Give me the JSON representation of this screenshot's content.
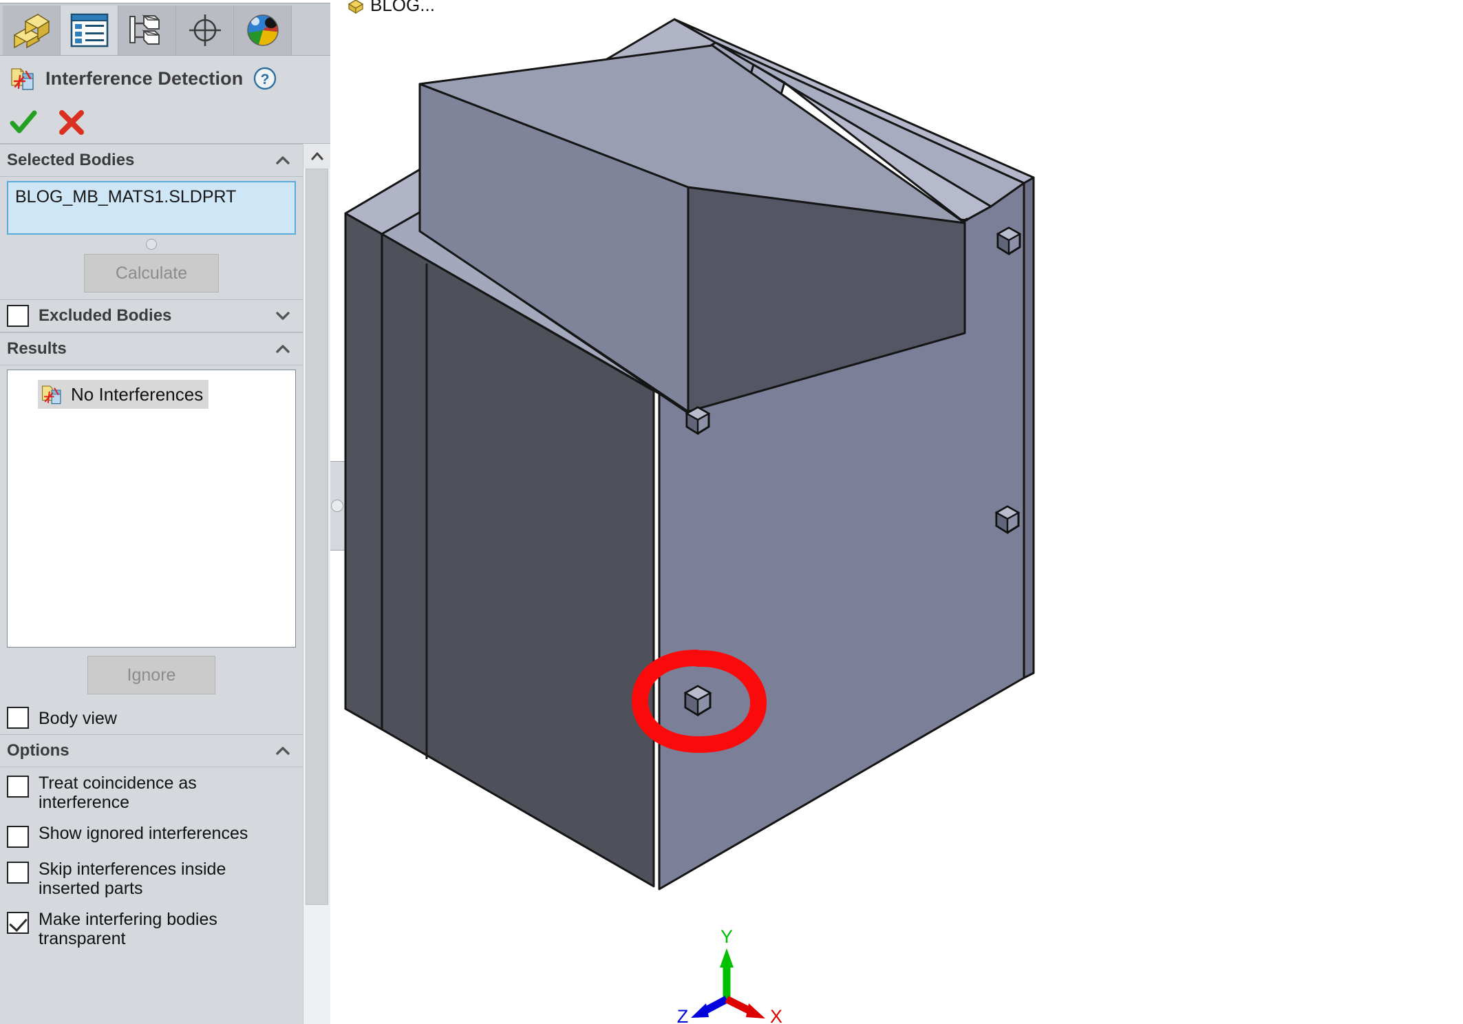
{
  "app": {
    "panel_title": "Interference Detection",
    "panel_icon": "interference-detection-icon",
    "help_icon": "help-question-icon",
    "ok_icon": "green-check-icon",
    "cancel_icon": "red-x-icon"
  },
  "tabs": [
    {
      "id": "feature-manager",
      "icon": "yellow-blocks-icon",
      "active": false
    },
    {
      "id": "property-manager",
      "icon": "blue-list-icon",
      "active": true
    },
    {
      "id": "configuration-manager",
      "icon": "config-tree-icon",
      "active": false
    },
    {
      "id": "dimxpert-manager",
      "icon": "crosshair-target-icon",
      "active": false
    },
    {
      "id": "display-manager",
      "icon": "color-sphere-icon",
      "active": false
    }
  ],
  "sections": {
    "selected_bodies": {
      "title": "Selected Bodies",
      "collapse_state": "expanded",
      "chevron": "chevron-up-icon",
      "selection_value": "BLOG_MB_MATS1.SLDPRT",
      "calculate_label": "Calculate",
      "calculate_enabled": false
    },
    "excluded_bodies": {
      "title": "Excluded Bodies",
      "collapse_state": "collapsed",
      "chevron": "chevron-down-icon",
      "checked": false
    },
    "results": {
      "title": "Results",
      "collapse_state": "expanded",
      "chevron": "chevron-up-icon",
      "items": [
        {
          "label": "No Interferences",
          "icon": "interference-detection-icon",
          "selected": true
        }
      ],
      "ignore_label": "Ignore",
      "ignore_enabled": false,
      "body_view_label": "Body view",
      "body_view_checked": false
    },
    "options": {
      "title": "Options",
      "collapse_state": "expanded",
      "chevron": "chevron-up-icon",
      "checkboxes": [
        {
          "label": "Treat coincidence as interference",
          "checked": false
        },
        {
          "label": "Show ignored interferences",
          "checked": false
        },
        {
          "label": "Skip interferences inside inserted parts",
          "checked": false
        },
        {
          "label": "Make interfering bodies transparent",
          "checked": true
        }
      ]
    }
  },
  "feature_tree": {
    "truncated_label": "BLOG..."
  },
  "graphics": {
    "triad": {
      "x_label": "X",
      "y_label": "Y",
      "z_label": "Z",
      "x_color": "#dd0000",
      "y_color": "#00c000",
      "z_color": "#0000dd"
    },
    "annotation": {
      "type": "hand-drawn-circle",
      "color": "#fa0a0a",
      "target": "hex-bolt-lower-left"
    },
    "model": {
      "name": "sheet-metal-enclosure",
      "rim_color": "#a8acc0",
      "rim_light_color": "#b2b6c8",
      "interior_light_color": "#80849a",
      "interior_dark_color": "#545663",
      "front_face_color": "#50525c",
      "right_face_color": "#7b7f97",
      "edge_color": "#1a1a1a",
      "bolt_count": 4
    }
  },
  "scrollbar": {
    "up_icon": "chevron-up-icon",
    "down_icon": "chevron-down-icon"
  }
}
